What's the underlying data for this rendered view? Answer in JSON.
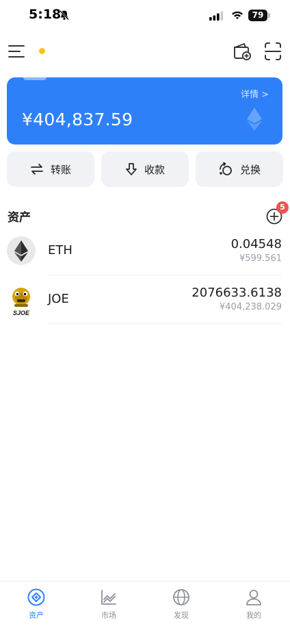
{
  "status_bar": {
    "time": "5:18",
    "battery": "79"
  },
  "card": {
    "details_label": "详情 >",
    "balance": "¥404,837.59"
  },
  "actions": [
    {
      "label": "转账"
    },
    {
      "label": "收款"
    },
    {
      "label": "兑换"
    }
  ],
  "assets": {
    "title": "资产",
    "badge_count": "5",
    "items": [
      {
        "symbol": "ETH",
        "amount": "0.04548",
        "value": "¥599.561"
      },
      {
        "symbol": "JOE",
        "amount": "2076633.6138",
        "value": "¥404,238.029",
        "logo_text": "SJOE"
      }
    ]
  },
  "bottom_nav": [
    {
      "label": "资产",
      "active": true
    },
    {
      "label": "市场"
    },
    {
      "label": "发现"
    },
    {
      "label": "我的"
    }
  ],
  "colors": {
    "accent": "#2e80f8",
    "badge": "#f0524f",
    "dot": "#f5c518"
  }
}
